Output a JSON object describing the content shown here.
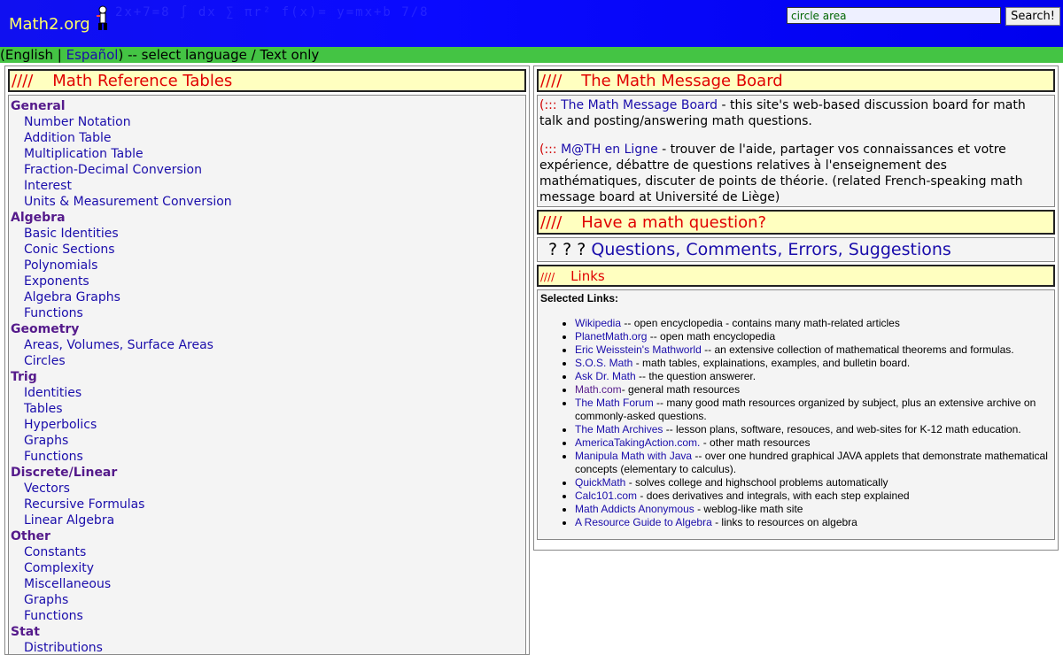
{
  "header": {
    "logo": "Math2.org",
    "noise_text": "2x+7=8  ∫ dx  ∑  πr²  f(x)=  y=mx+b  7/8",
    "search_value": "circle area",
    "search_button": "Search!"
  },
  "langbar": {
    "open": "(English | ",
    "espanol": "Español",
    "rest": ") -- select language / Text only"
  },
  "reference": {
    "slashes": "////",
    "title": "Math Reference Tables",
    "groups": [
      {
        "cat": "General",
        "items": [
          "Number Notation",
          "Addition Table",
          "Multiplication Table",
          "Fraction-Decimal Conversion",
          "Interest",
          "Units & Measurement Conversion"
        ]
      },
      {
        "cat": "Algebra",
        "items": [
          "Basic Identities",
          "Conic Sections",
          "Polynomials",
          "Exponents",
          "Algebra Graphs",
          "Functions"
        ]
      },
      {
        "cat": "Geometry",
        "items": [
          "Areas, Volumes, Surface Areas",
          "Circles"
        ]
      },
      {
        "cat": "Trig",
        "items": [
          "Identities",
          "Tables",
          "Hyperbolics",
          "Graphs",
          "Functions"
        ]
      },
      {
        "cat": "Discrete/Linear",
        "items": [
          "Vectors",
          "Recursive Formulas",
          "Linear Algebra"
        ]
      },
      {
        "cat": "Other",
        "items": [
          "Constants",
          "Complexity",
          "Miscellaneous",
          "Graphs",
          "Functions"
        ]
      },
      {
        "cat": "Stat",
        "items": [
          "Distributions"
        ]
      }
    ]
  },
  "board": {
    "slashes": "////",
    "title": "The Math Message Board",
    "entry1": {
      "paren": "(:::",
      "link": "The Math Message Board",
      "text": " - this site's web-based discussion board for math talk and posting/answering math questions."
    },
    "entry2": {
      "paren": "(:::",
      "link": "M@TH en Ligne",
      "text": " - trouver de l'aide, partager vos connaissances et votre expérience, débattre de questions relatives à l'enseignement des mathématiques, discuter de points de théorie. (related French-speaking math message board at Université de Liège)"
    }
  },
  "question": {
    "slashes": "////",
    "title": "Have a math question?",
    "prefix": "? ? ? ",
    "link": "Questions, Comments, Errors, Suggestions"
  },
  "links": {
    "slashes": "////",
    "title": "Links",
    "selected": "Selected Links:",
    "items": [
      {
        "link": "Wikipedia",
        "desc": " -- open encyclopedia - contains many math-related articles"
      },
      {
        "link": "PlanetMath.org",
        "desc": " -- open math encyclopedia"
      },
      {
        "link": "Eric Weisstein's Mathworld",
        "desc": " -- an extensive collection of mathematical theorems and formulas."
      },
      {
        "link": "S.O.S. Math",
        "desc": " - math tables, explainations, examples, and bulletin board."
      },
      {
        "link": "Ask Dr. Math",
        "desc": " -- the question answerer."
      },
      {
        "link": "Math.com",
        "desc": "- general math resources",
        "visited": true
      },
      {
        "link": "The Math Forum",
        "desc": " -- many good math resources organized by subject, plus an extensive archive on commonly-asked questions."
      },
      {
        "link": "The Math Archives",
        "desc": " -- lesson plans, software, resouces, and web-sites for K-12 math education."
      },
      {
        "link": "AmericaTakingAction.com.",
        "desc": " - other math resources"
      },
      {
        "link": "Manipula Math with Java",
        "desc": " -- over one hundred graphical JAVA applets that demonstrate mathematical concepts (elementary to calculus)."
      },
      {
        "link": "QuickMath",
        "desc": " - solves college and highschool problems automatically"
      },
      {
        "link": "Calc101.com",
        "desc": " - does derivatives and integrals, with each step explained"
      },
      {
        "link": "Math Addicts Anonymous",
        "desc": " - weblog-like math site"
      },
      {
        "link": "A Resource Guide to Algebra",
        "desc": " - links to resources on algebra"
      }
    ]
  }
}
